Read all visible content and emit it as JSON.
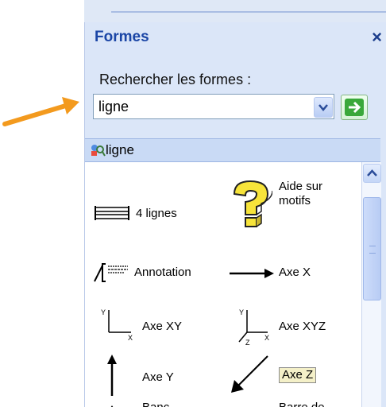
{
  "panel": {
    "title": "Formes",
    "close_label": "×"
  },
  "search": {
    "label": "Rechercher les formes :",
    "value": "ligne"
  },
  "results": {
    "header_label": "ligne",
    "items": [
      {
        "label": "4 lignes",
        "icon": "four-lines-icon"
      },
      {
        "label_line1": "Aide sur",
        "label_line2": "motifs",
        "icon": "question-mark-icon"
      },
      {
        "label": "Annotation",
        "icon": "annotation-icon"
      },
      {
        "label": "Axe X",
        "icon": "arrow-right-icon"
      },
      {
        "label": "Axe XY",
        "icon": "axis-xy-icon",
        "axis_y": "Y",
        "axis_x": "X"
      },
      {
        "label": "Axe XYZ",
        "icon": "axis-xyz-icon",
        "axis_y": "Y",
        "axis_x": "X",
        "axis_z": "Z"
      },
      {
        "label": "Axe Y",
        "icon": "arrow-up-icon"
      },
      {
        "label": "Axe Z",
        "icon": "arrow-diagonal-icon"
      },
      {
        "label": "Banc",
        "icon": "bench-icon"
      },
      {
        "label": "Barre de",
        "icon": "bar-icon"
      }
    ]
  },
  "colors": {
    "annotation_arrow": "#f39a1e",
    "panel_bg": "#dbe6f8",
    "title": "#1b46a6"
  }
}
